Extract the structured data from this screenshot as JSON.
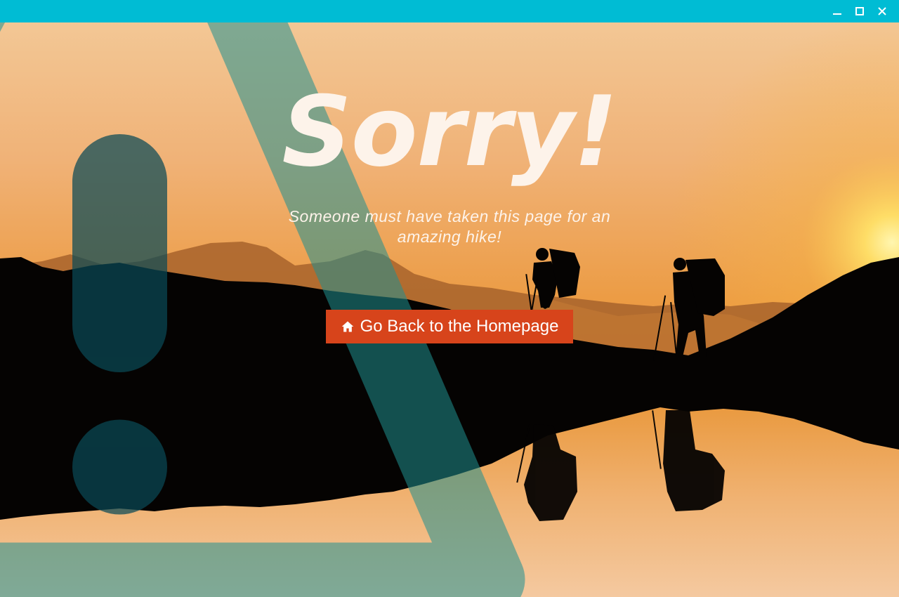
{
  "window": {
    "minimize_icon": "minimize-icon",
    "maximize_icon": "maximize-icon",
    "close_icon": "close-icon",
    "titlebar_color": "#00bcd4"
  },
  "error_page": {
    "headline": "Sorry!",
    "subtitle": "Someone must have taken this page for an amazing hike!",
    "button": {
      "label": "Go Back to the Homepage",
      "icon": "home-icon",
      "color": "#d7441b"
    },
    "overlay_icon": "warning-triangle-icon"
  }
}
